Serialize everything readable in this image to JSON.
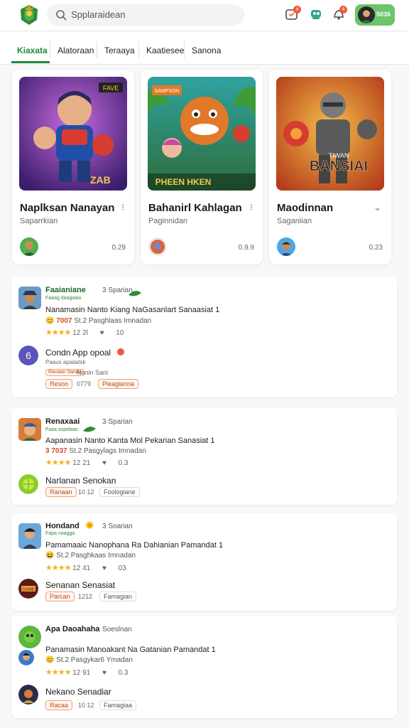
{
  "header": {
    "search_placeholder": "Spplaraidean",
    "notif_badge_1": "4",
    "notif_badge_2": "4",
    "account_label": "5036"
  },
  "tabs": [
    "Kiaxata",
    "Alatoraan",
    "Teraaya",
    "Kaatiesee",
    "Sanona"
  ],
  "featured": [
    {
      "title": "Naplksan Nanayan",
      "sub": "Saparrkian",
      "value": "0.29",
      "art_text": "ZAB",
      "art_tag": "FAVE"
    },
    {
      "title": "Bahanirl Kahlagan",
      "sub": "Paginnidan",
      "value": "0.9.9",
      "art_text": "PHEEN HKEN",
      "art_tag": "SAMPSON"
    },
    {
      "title": "Maodinnan",
      "sub": "Saganiian",
      "value": "0.23",
      "art_text": "BANSIAI",
      "art_tag": "TIWAN"
    }
  ],
  "list": [
    {
      "name": "Faaianiane",
      "time": "3 Sparian",
      "sub": "Faaag daagaaio",
      "text": "Nanamasin Nanto Kiang NaGasanlart Sanaasiat 1",
      "meta_hl": "7007",
      "meta": "St.2 Pasghlaas Imnadan",
      "stars": "★★★★",
      "stat1": "12 2l",
      "stat2": "10",
      "reply": {
        "name": "Condn App opoal",
        "sub": "Paaus apaiiatsk",
        "tag_small": "Ranaan Sanda",
        "tag_label": "Nanin Sani",
        "pill1": "Resoo",
        "pill1_val": "0779",
        "pill2": "Pleagianna"
      }
    },
    {
      "name": "Renaxaai",
      "time": "3 Sparian",
      "sub": "Faaa aspidaas",
      "text": "Aapanasin Nanto Kanta Mol Pekarian Sanasiat 1",
      "meta_hl": "3 7037",
      "meta": "St.2 Pasgylags Imnadan",
      "stars": "★★★★",
      "stat1": "12 21",
      "stat2": "0.3",
      "reply": {
        "name": "Narlanan Senokan",
        "pill1": "Ranaan",
        "pill1_val": "10 12",
        "pill2": "Foologiane"
      }
    },
    {
      "name": "Hondand",
      "time": "3 Soarian",
      "sub": "Fapa naagga",
      "text": "Pamamaaic Nanophana Ra Dahianian Pamandat 1",
      "meta_hl": "",
      "meta": "St.2 Pasghkaas Imnadan",
      "stars": "★★★★",
      "stat1": "12 41",
      "stat2": "03",
      "reply": {
        "name": "Senanan Senasiat",
        "pill1": "Parcan",
        "pill1_val": "1212",
        "pill2": "Famagian"
      }
    },
    {
      "name": "Apa Daoahaha",
      "time": "Soeslnan",
      "sub": "",
      "text": "Panamasin Manoakant Na Gatanian Pamandat 1",
      "meta_hl": "",
      "meta": "St.2 Pasgykar6 Ymadan",
      "stars": "★★★★",
      "stat1": "12 91",
      "stat2": "0.3",
      "reply": {
        "name": "Nekano Senadiar",
        "pill1": "Racaa",
        "pill1_val": "10 12",
        "pill2": "Famagiaa"
      }
    }
  ],
  "colors": {
    "accent": "#1f8a3a",
    "orange": "#f05a3a",
    "star": "#f3b21b"
  }
}
